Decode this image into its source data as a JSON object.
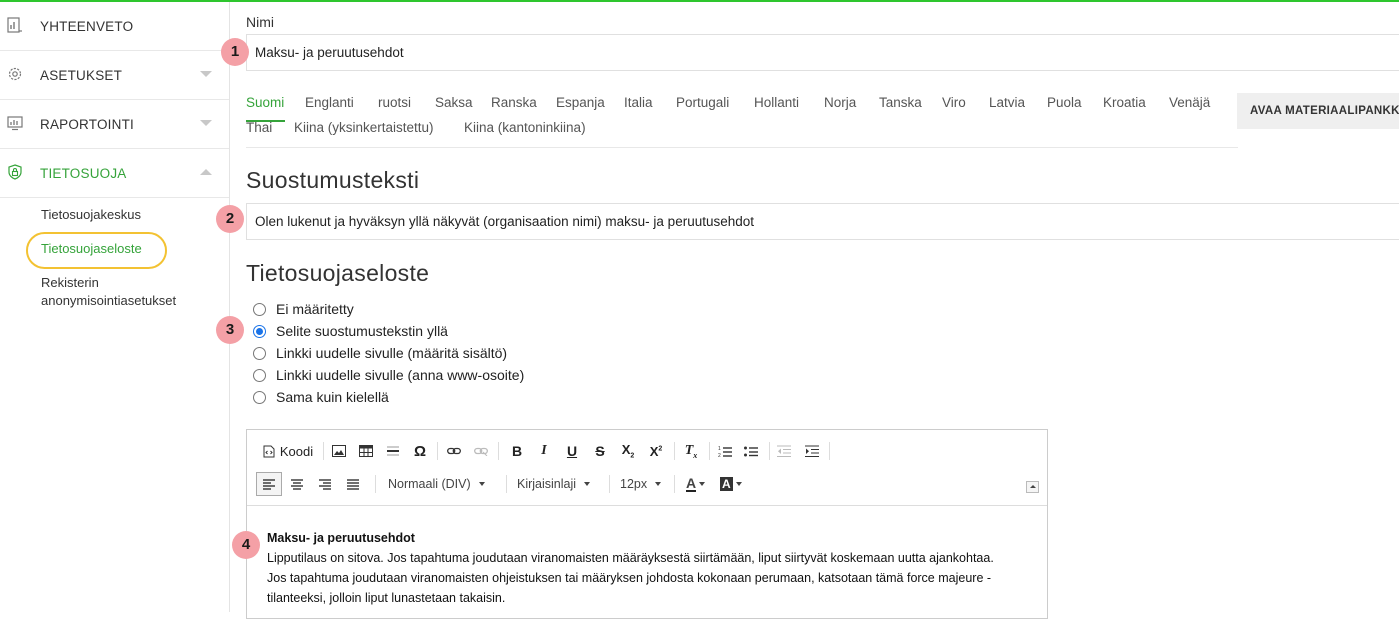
{
  "sidebar": {
    "items": [
      {
        "label": "YHTEENVETO"
      },
      {
        "label": "ASETUKSET"
      },
      {
        "label": "RAPORTOINTI"
      },
      {
        "label": "TIETOSUOJA"
      }
    ],
    "subitems": [
      {
        "label": "Tietosuojakeskus"
      },
      {
        "label": "Tietosuojaseloste"
      },
      {
        "label": "Rekisterin"
      },
      {
        "label": "anonymisointiasetukset"
      }
    ]
  },
  "form": {
    "name_label": "Nimi",
    "name_value": "Maksu- ja peruutusehdot",
    "consent_title": "Suostumusteksti",
    "consent_value": "Olen lukenut ja hyväksyn yllä näkyvät (organisaation nimi) maksu- ja peruutusehdot",
    "policy_title": "Tietosuojaseloste"
  },
  "badges": [
    "1",
    "2",
    "3",
    "4"
  ],
  "tabs": [
    "Suomi",
    "Englanti",
    "ruotsi",
    "Saksa",
    "Ranska",
    "Espanja",
    "Italia",
    "Portugali",
    "Hollanti",
    "Norja",
    "Tanska",
    "Viro",
    "Latvia",
    "Puola",
    "Kroatia",
    "Venäjä",
    "Thai",
    "Kiina (yksinkertaistettu)",
    "Kiina (kantoninkiina)"
  ],
  "material_button": "AVAA MATERIAALIPANKKI",
  "radios": [
    {
      "label": "Ei määritetty",
      "checked": false
    },
    {
      "label": "Selite suostumustekstin yllä",
      "checked": true
    },
    {
      "label": "Linkki uudelle sivulle (määritä sisältö)",
      "checked": false
    },
    {
      "label": "Linkki uudelle sivulle (anna www-osoite)",
      "checked": false
    },
    {
      "label": "Sama kuin kielellä",
      "checked": false
    }
  ],
  "editor": {
    "source_label": "Koodi",
    "format_combo": "Normaali (DIV)",
    "font_combo": "Kirjaisinlaji",
    "size_combo": "12px",
    "content_heading": "Maksu- ja peruutusehdot",
    "content_lines": [
      "Lipputilaus on sitova. Jos tapahtuma joudutaan viranomaisten määräyksestä siirtämään, liput siirtyvät koskemaan uutta ajankohtaa.",
      "Jos tapahtuma joudutaan viranomaisten ohjeistuksen tai määryksen johdosta kokonaan perumaan, katsotaan tämä force majeure -",
      "tilanteeksi, jolloin liput lunastetaan takaisin."
    ]
  },
  "colors": {
    "accent": "#35a33a",
    "highlight": "#f3c232",
    "badge": "#f4a0a6",
    "radio": "#1a73e8"
  }
}
